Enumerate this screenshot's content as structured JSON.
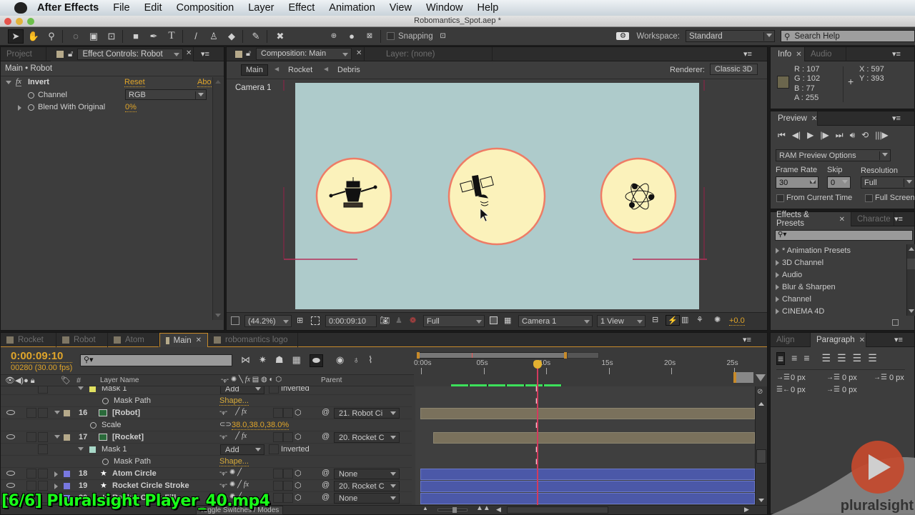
{
  "menubar": {
    "app_name": "After Effects",
    "items": [
      "File",
      "Edit",
      "Composition",
      "Layer",
      "Effect",
      "Animation",
      "View",
      "Window",
      "Help"
    ]
  },
  "window": {
    "title": "Robomantics_Spot.aep *"
  },
  "toolbar": {
    "snapping_label": "Snapping",
    "workspace_label": "Workspace:",
    "workspace_value": "Standard",
    "search_placeholder": "Search Help"
  },
  "effect_controls": {
    "tabs": {
      "project": "Project",
      "effect_controls": "Effect Controls: Robot"
    },
    "breadcrumb": "Main • Robot",
    "effect_name": "Invert",
    "reset_label": "Reset",
    "about_label": "Abo",
    "properties": [
      {
        "name": "Channel",
        "value": "RGB"
      },
      {
        "name": "Blend With Original",
        "value": "0%"
      }
    ]
  },
  "composition": {
    "tab_label": "Composition: Main",
    "layer_tab_label": "Layer: (none)",
    "flowchart": [
      "Main",
      "Rocket",
      "Debris"
    ],
    "renderer_label": "Renderer:",
    "renderer_value": "Classic 3D",
    "camera_label": "Camera 1",
    "colors": {
      "background": "#aecbcb",
      "circle_fill": "#fbf2bb",
      "circle_stroke": "#ee7c66"
    },
    "footer": {
      "zoom": "(44.2%)",
      "timecode": "0:00:09:10",
      "resolution": "Full",
      "camera": "Camera 1",
      "views": "1 View",
      "exposure": "+0.0"
    }
  },
  "info": {
    "tabs": [
      "Info",
      "Audio"
    ],
    "r": "R : 107",
    "g": "G : 102",
    "b": "B : 77",
    "a": "A : 255",
    "x": "X : 597",
    "y": "Y : 393",
    "sample_color": "#6b664d"
  },
  "preview": {
    "tab": "Preview",
    "ram_options": "RAM Preview Options",
    "frame_rate_label": "Frame Rate",
    "skip_label": "Skip",
    "resolution_label": "Resolution",
    "frame_rate": "30",
    "skip": "0",
    "resolution": "Full",
    "from_current_time": "From Current Time",
    "full_screen": "Full Screen"
  },
  "effects_presets": {
    "tabs": [
      "Effects & Presets",
      "Characte"
    ],
    "items": [
      "* Animation Presets",
      "3D Channel",
      "Audio",
      "Blur & Sharpen",
      "Channel",
      "CINEMA 4D"
    ]
  },
  "paragraph": {
    "tabs": [
      "Align",
      "Paragraph"
    ],
    "values": [
      "0 px",
      "0 px",
      "0 px",
      "0 px",
      "0 px"
    ]
  },
  "timeline": {
    "tabs": [
      "Rocket",
      "Robot",
      "Atom",
      "Main",
      "robomantics logo"
    ],
    "active_tab": "Main",
    "current_time": "0:00:09:10",
    "frame_info": "00280 (30.00 fps)",
    "columns": {
      "layer_name": "Layer Name",
      "parent": "Parent",
      "number": "#"
    },
    "ruler": [
      "0:00s",
      "05s",
      "10s",
      "15s",
      "20s",
      "25s"
    ],
    "rows": [
      {
        "type": "mask",
        "name": "Mask 1",
        "mode": "Add",
        "inverted": "Inverted",
        "color": "#e0e060"
      },
      {
        "type": "prop",
        "name": "Mask Path",
        "value": "Shape..."
      },
      {
        "type": "layer",
        "num": "16",
        "name": "[Robot]",
        "parent": "21. Robot Ci",
        "color": "#b5a98a"
      },
      {
        "type": "prop2",
        "name": "Scale",
        "value": "38.0,38.0,38.0%"
      },
      {
        "type": "layer",
        "num": "17",
        "name": "[Rocket]",
        "parent": "20. Rocket C",
        "color": "#b5a98a"
      },
      {
        "type": "mask",
        "name": "Mask 1",
        "mode": "Add",
        "inverted": "Inverted",
        "color": "#a8d8c8"
      },
      {
        "type": "prop",
        "name": "Mask Path",
        "value": "Shape..."
      },
      {
        "type": "shape",
        "num": "18",
        "name": "Atom Circle",
        "parent": "None",
        "color": "#7878e0"
      },
      {
        "type": "shape",
        "num": "19",
        "name": "Rocket Circle Stroke",
        "parent": "20. Rocket C",
        "color": "#7878e0"
      },
      {
        "type": "shape",
        "num": "20",
        "name": "Rocket Circle Fill",
        "parent": "None",
        "color": "#7878e0"
      }
    ],
    "toggle_label": "Toggle Switches / Modes"
  },
  "overlay": {
    "caption": "[6/6] Pluralsight Player_40.mp4",
    "brand": "pluralsight"
  }
}
